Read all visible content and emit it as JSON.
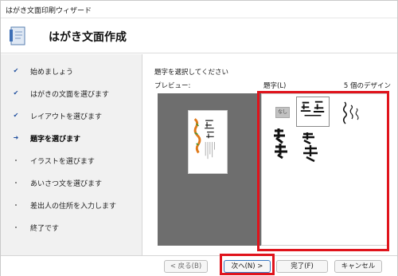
{
  "window": {
    "title": "はがき文面印刷ウィザード"
  },
  "header": {
    "heading": "はがき文面作成"
  },
  "steps": [
    {
      "label": "始めましょう",
      "state": "done"
    },
    {
      "label": "はがきの文面を選びます",
      "state": "done"
    },
    {
      "label": "レイアウトを選びます",
      "state": "done"
    },
    {
      "label": "題字を選びます",
      "state": "current"
    },
    {
      "label": "イラストを選びます",
      "state": "pending"
    },
    {
      "label": "あいさつ文を選びます",
      "state": "pending"
    },
    {
      "label": "差出人の住所を入力します",
      "state": "pending"
    },
    {
      "label": "終了です",
      "state": "pending"
    }
  ],
  "main": {
    "instruction": "題字を選択してください",
    "preview_label": "プレビュー:",
    "list_label": "題字(L)",
    "count_label": "5 個のデザイン",
    "none_item": "なし"
  },
  "buttons": {
    "back": "< 戻る(B)",
    "next": "次へ(N) >",
    "finish": "完了(F)",
    "cancel": "キャンセル"
  },
  "colors": {
    "highlight": "#e0141c",
    "sidebar_bg": "#f1f1f1",
    "preview_bg": "#6e6e6e",
    "check": "#1f4e9e"
  }
}
